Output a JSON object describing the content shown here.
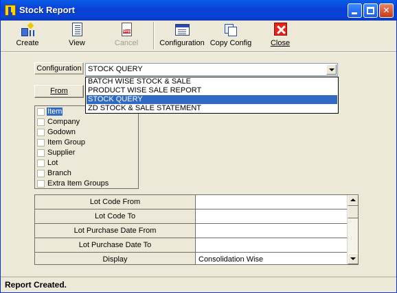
{
  "window": {
    "title": "Stock Report"
  },
  "toolbar": {
    "buttons": [
      {
        "label": "Create",
        "icon": "create-icon",
        "enabled": true
      },
      {
        "label": "View",
        "icon": "view-report-icon",
        "enabled": true
      },
      {
        "label": "Cancel",
        "icon": "stop-icon",
        "enabled": false
      },
      {
        "label": "Configuration",
        "icon": "configuration-icon",
        "enabled": true
      },
      {
        "label": "Copy Config",
        "icon": "copy-config-icon",
        "enabled": true
      },
      {
        "label": "Close",
        "icon": "close-icon",
        "enabled": true
      }
    ],
    "cancel_icon_text": "Stop"
  },
  "configuration": {
    "label": "Configuration",
    "selected": "STOCK QUERY",
    "options": [
      "BATCH WISE STOCK & SALE",
      "PRODUCT WISE SALE REPORT",
      "STOCK QUERY",
      "ZD STOCK & SALE STATEMENT"
    ],
    "highlighted_index": 2
  },
  "from_button": {
    "label": "From"
  },
  "filters": {
    "items": [
      {
        "label": "Item",
        "checked": false,
        "selected": true
      },
      {
        "label": "Company",
        "checked": false,
        "selected": false
      },
      {
        "label": "Godown",
        "checked": false,
        "selected": false
      },
      {
        "label": "Item Group",
        "checked": false,
        "selected": false
      },
      {
        "label": "Supplier",
        "checked": false,
        "selected": false
      },
      {
        "label": "Lot",
        "checked": false,
        "selected": false
      },
      {
        "label": "Branch",
        "checked": false,
        "selected": false
      },
      {
        "label": "Extra Item Groups",
        "checked": false,
        "selected": false
      }
    ]
  },
  "parameters": {
    "rows": [
      {
        "name": "Lot Code From",
        "value": ""
      },
      {
        "name": "Lot Code To",
        "value": ""
      },
      {
        "name": "Lot Purchase Date From",
        "value": ""
      },
      {
        "name": "Lot Purchase Date To",
        "value": ""
      },
      {
        "name": "Display",
        "value": "Consolidation Wise"
      }
    ]
  },
  "status": {
    "text": "Report Created."
  },
  "colors": {
    "titlebar": "#0a4fe0",
    "selection": "#316ac5",
    "face": "#ece9d8"
  }
}
